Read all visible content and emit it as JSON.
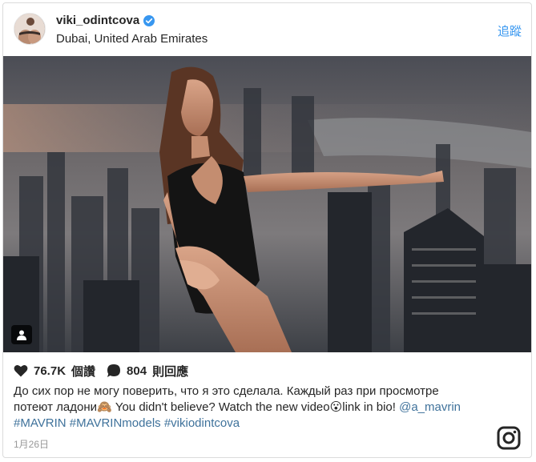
{
  "header": {
    "username": "viki_odintcova",
    "location": "Dubai, United Arab Emirates",
    "follow_label": "追蹤"
  },
  "stats": {
    "likes_count": "76.7K",
    "likes_label": "個讚",
    "comments_count": "804",
    "comments_label": "則回應"
  },
  "caption": {
    "line1": "До сих пор не могу поверить, что я это сделала. Каждый раз при просмотре",
    "line2_a": "потеют ладони🙈 You didn't believe? Watch the new video😮link in bio! ",
    "mention": "@a_mavrin",
    "hashtags": "#MAVRIN #MAVRINmodels #vikiodintcova"
  },
  "timestamp": "1月26日",
  "colors": {
    "accent": "#3897f0",
    "link": "#3f729b",
    "text": "#262626",
    "muted": "#999999",
    "border": "#dbdbdb"
  },
  "icons": {
    "verified": "verified-badge-icon",
    "heart": "heart-icon",
    "comment": "comment-bubble-icon",
    "user_tag": "user-tag-icon",
    "brand": "instagram-logo-icon"
  }
}
